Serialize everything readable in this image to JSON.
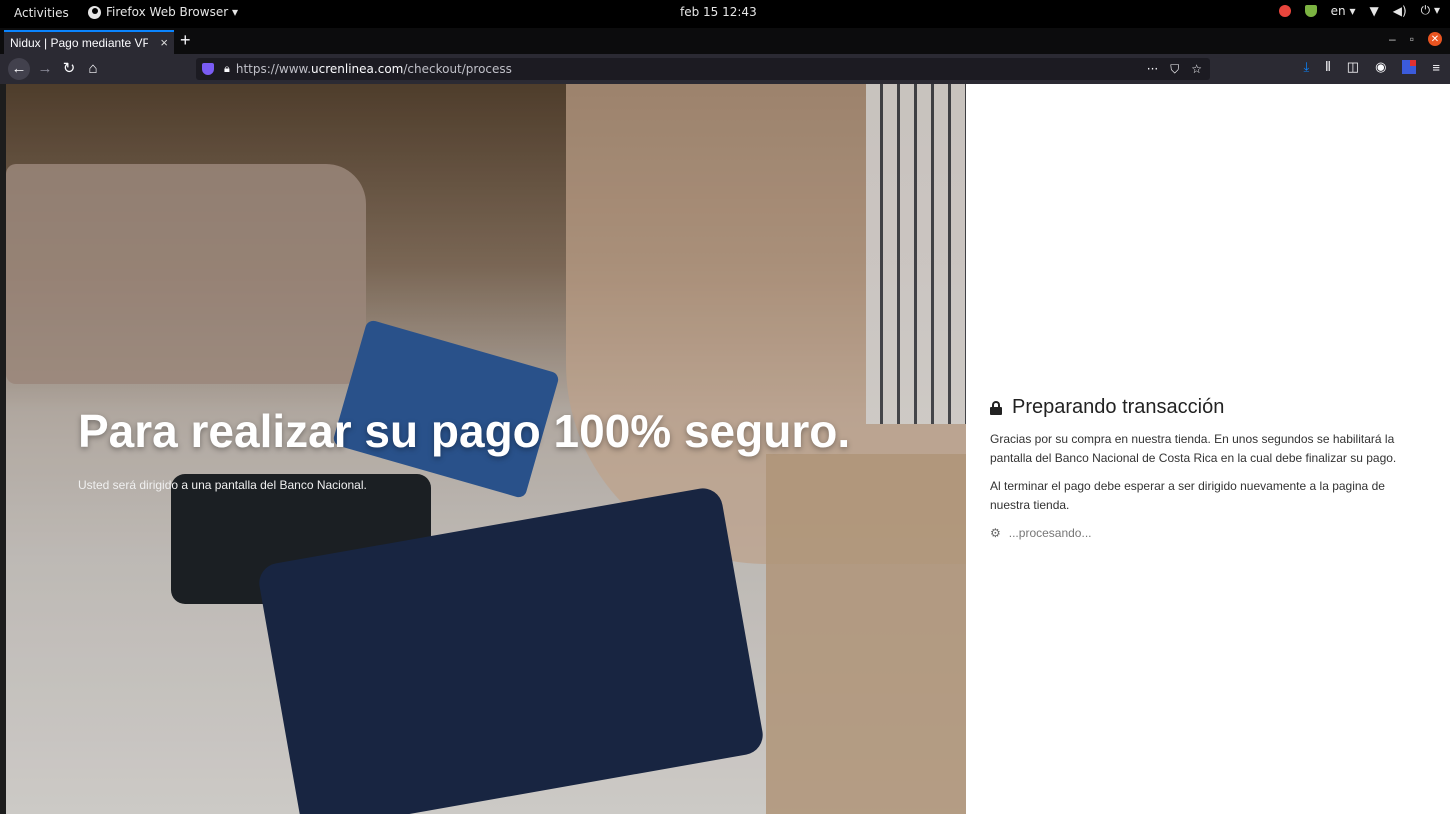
{
  "system": {
    "activities": "Activities",
    "app_name": "Firefox Web Browser ▾",
    "clock": "feb 15 12:43",
    "lang": "en ▾"
  },
  "browser": {
    "tab_title": "Nidux | Pago mediante VPOS",
    "tab_close": "×",
    "new_tab": "+",
    "url_scheme": "https://www.",
    "url_domain": "ucrenlinea.com",
    "url_path": "/checkout/process",
    "page_actions": "···",
    "accent": "#0a84ff"
  },
  "hero": {
    "headline": "Para realizar su pago 100% seguro.",
    "subtext": "Usted será dirigido a una pantalla del Banco Nacional."
  },
  "panel": {
    "title": "Preparando transacción",
    "paragraph_1": "Gracias por su compra en nuestra tienda. En unos segundos se habilitará la pantalla del Banco Nacional de Costa Rica en la cual debe finalizar su pago.",
    "paragraph_2": "Al terminar el pago debe esperar a ser dirigido nuevamente a la pagina de nuestra tienda.",
    "processing": "...procesando..."
  }
}
